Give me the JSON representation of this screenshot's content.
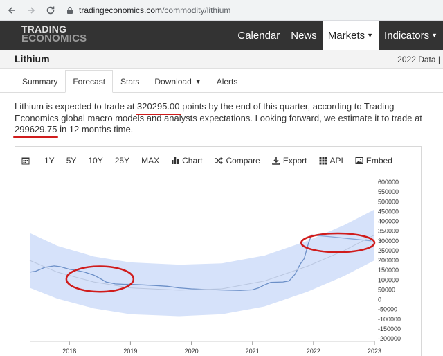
{
  "browser": {
    "back_icon": "arrow-left-icon",
    "forward_icon": "arrow-right-icon",
    "reload_icon": "reload-icon",
    "url_host": "tradingeconomics.com",
    "url_path": "/commodity/lithium"
  },
  "site": {
    "logo_line1": "TRADING",
    "logo_line2": "ECONOMICS",
    "nav": [
      {
        "label": "Calendar"
      },
      {
        "label": "News"
      },
      {
        "label": "Markets"
      },
      {
        "label": "Indicators"
      }
    ]
  },
  "title_bar": {
    "title": "Lithium",
    "data_label": "2022 Data |"
  },
  "tabs": [
    {
      "label": "Summary"
    },
    {
      "label": "Forecast"
    },
    {
      "label": "Stats"
    },
    {
      "label": "Download"
    },
    {
      "label": "Alerts"
    }
  ],
  "description": {
    "p1": "Lithium is expected to trade at ",
    "v1": "320295.00",
    "p2": " points by the end of this quarter, according to Trading Economics global macro models and analysts expectations. Looking forward, we estimate it to trade at ",
    "v2": "299629.75",
    "p3": " in 12 months time."
  },
  "toolbar": {
    "items": [
      {
        "label": "",
        "icon": "calendar-icon"
      },
      {
        "label": "1Y"
      },
      {
        "label": "5Y"
      },
      {
        "label": "10Y"
      },
      {
        "label": "25Y"
      },
      {
        "label": "MAX"
      },
      {
        "label": "Chart",
        "icon": "bar-chart-icon"
      },
      {
        "label": "Compare",
        "icon": "shuffle-icon"
      },
      {
        "label": "Export",
        "icon": "download-icon"
      },
      {
        "label": "API",
        "icon": "grid-icon"
      },
      {
        "label": "Embed",
        "icon": "image-icon"
      }
    ]
  },
  "chart_data": {
    "type": "line",
    "title": "",
    "xlabel": "",
    "ylabel": "",
    "x_ticks": [
      "2018",
      "2019",
      "2020",
      "2021",
      "2022",
      "2023"
    ],
    "y_ticks": [
      "600000",
      "550000",
      "500000",
      "450000",
      "400000",
      "350000",
      "300000",
      "250000",
      "200000",
      "150000",
      "100000",
      "50000",
      "0",
      "-50000",
      "-100000",
      "-150000",
      "-200000"
    ],
    "ylim": [
      -200000,
      600000
    ],
    "xlim": [
      2017.35,
      2023.0
    ],
    "grid": false,
    "series": [
      {
        "role": "history",
        "color": "#6b8fc7",
        "points": [
          [
            2017.35,
            140000
          ],
          [
            2017.45,
            145000
          ],
          [
            2017.6,
            165000
          ],
          [
            2017.75,
            172000
          ],
          [
            2017.85,
            168000
          ],
          [
            2018.0,
            155000
          ],
          [
            2018.1,
            150000
          ],
          [
            2018.25,
            140000
          ],
          [
            2018.4,
            125000
          ],
          [
            2018.5,
            108000
          ],
          [
            2018.6,
            90000
          ],
          [
            2018.75,
            80000
          ],
          [
            2018.9,
            78000
          ],
          [
            2019.0,
            78000
          ],
          [
            2019.2,
            75000
          ],
          [
            2019.4,
            72000
          ],
          [
            2019.6,
            68000
          ],
          [
            2019.8,
            60000
          ],
          [
            2020.0,
            55000
          ],
          [
            2020.2,
            52000
          ],
          [
            2020.4,
            50000
          ],
          [
            2020.6,
            48000
          ],
          [
            2020.8,
            47000
          ],
          [
            2021.0,
            50000
          ],
          [
            2021.1,
            60000
          ],
          [
            2021.2,
            75000
          ],
          [
            2021.3,
            88000
          ],
          [
            2021.5,
            90000
          ],
          [
            2021.6,
            95000
          ],
          [
            2021.7,
            130000
          ],
          [
            2021.78,
            180000
          ],
          [
            2021.85,
            210000
          ],
          [
            2021.92,
            290000
          ],
          [
            2021.97,
            330000
          ]
        ]
      },
      {
        "role": "forecast",
        "color": "#8aa8d8",
        "points": [
          [
            2021.97,
            330000
          ],
          [
            2022.3,
            320295
          ],
          [
            2022.95,
            299630
          ]
        ]
      },
      {
        "role": "trend",
        "color": "#b9c6df",
        "points": [
          [
            2017.35,
            200000
          ],
          [
            2017.8,
            140000
          ],
          [
            2018.4,
            90000
          ],
          [
            2019.0,
            60000
          ],
          [
            2019.8,
            48000
          ],
          [
            2020.5,
            55000
          ],
          [
            2021.2,
            95000
          ],
          [
            2021.9,
            170000
          ],
          [
            2022.5,
            250000
          ],
          [
            2023.0,
            330000
          ]
        ]
      }
    ],
    "band": {
      "color": "#d6e2fa",
      "upper": [
        [
          2017.35,
          340000
        ],
        [
          2017.8,
          275000
        ],
        [
          2018.4,
          220000
        ],
        [
          2019.0,
          190000
        ],
        [
          2019.8,
          178000
        ],
        [
          2020.5,
          185000
        ],
        [
          2021.2,
          225000
        ],
        [
          2021.9,
          300000
        ],
        [
          2022.5,
          380000
        ],
        [
          2023.0,
          460000
        ]
      ],
      "lower": [
        [
          2017.35,
          60000
        ],
        [
          2017.8,
          5000
        ],
        [
          2018.4,
          -45000
        ],
        [
          2019.0,
          -75000
        ],
        [
          2019.8,
          -85000
        ],
        [
          2020.5,
          -75000
        ],
        [
          2021.2,
          -35000
        ],
        [
          2021.9,
          40000
        ],
        [
          2022.5,
          120000
        ],
        [
          2023.0,
          200000
        ]
      ]
    },
    "annotations": [
      {
        "shape": "ellipse",
        "color": "#d01c1c",
        "cx": 2018.5,
        "cy": 105000,
        "rx": 0.55,
        "ry": 65000
      },
      {
        "shape": "ellipse",
        "color": "#d01c1c",
        "cx": 2022.4,
        "cy": 290000,
        "rx": 0.6,
        "ry": 48000
      }
    ]
  }
}
